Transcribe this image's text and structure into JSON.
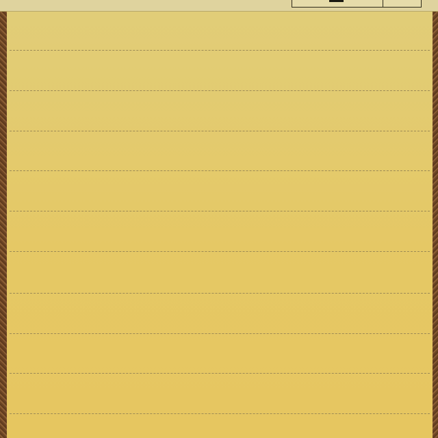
{
  "window": {
    "title": ""
  },
  "toolbar": {
    "buttons": [
      {
        "id": "main-button",
        "label": ""
      },
      {
        "id": "side-button",
        "label": ""
      }
    ]
  },
  "notepad": {
    "text": "",
    "lined": true,
    "line_style": "dashed",
    "paper_color": "#e5c865",
    "line_color": "#9c8a55",
    "frame_color": "#7a5230"
  }
}
